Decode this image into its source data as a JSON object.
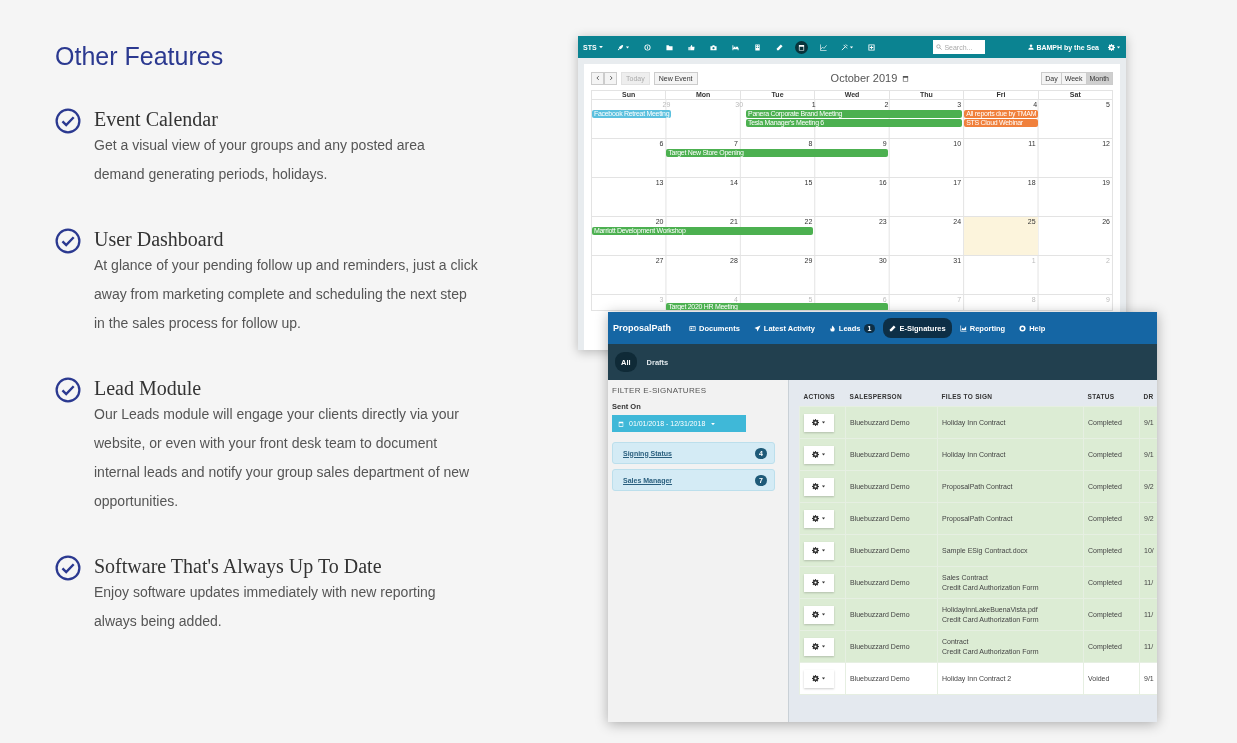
{
  "features": {
    "heading": "Other Features",
    "items": [
      {
        "title": "Event Calendar",
        "text": "Get a visual view of your groups and any posted area demand generating periods, holidays."
      },
      {
        "title": "User Dashboard",
        "text": "At glance of your pending follow up and reminders, just a click away from marketing complete and scheduling the next step in the sales process for follow up."
      },
      {
        "title": "Lead Module",
        "text": "Our Leads module will engage your clients directly via your website, or even with your front desk team to document internal leads and notify your group sales department of new opportunities."
      },
      {
        "title": "Software That's Always Up To Date",
        "text": "Enjoy software updates immediately with new reporting always being added."
      }
    ]
  },
  "calendar_app": {
    "brand": "STS",
    "toolbar_icons": [
      {
        "kind": "rocket",
        "caret": true,
        "selected": false
      },
      {
        "kind": "info",
        "caret": false,
        "selected": false
      },
      {
        "kind": "folder",
        "caret": false,
        "selected": false
      },
      {
        "kind": "thumb",
        "caret": false,
        "selected": false
      },
      {
        "kind": "camera",
        "caret": false,
        "selected": false
      },
      {
        "kind": "bed",
        "caret": false,
        "selected": false
      },
      {
        "kind": "building",
        "caret": false,
        "selected": false
      },
      {
        "kind": "pen",
        "caret": false,
        "selected": false
      },
      {
        "kind": "calendar",
        "caret": false,
        "selected": true
      },
      {
        "kind": "chart",
        "caret": false,
        "selected": false
      },
      {
        "kind": "tools",
        "caret": true,
        "selected": false
      },
      {
        "kind": "plus",
        "caret": false,
        "selected": false
      }
    ],
    "search": {
      "placeholder": "Search..."
    },
    "user": "BAMPH by the Sea",
    "buttons": [
      {
        "label": "Today",
        "disabled": true
      },
      {
        "label": "New Event",
        "disabled": false
      }
    ],
    "month_title": "October 2019",
    "views": [
      {
        "label": "Day",
        "selected": false
      },
      {
        "label": "Week",
        "selected": false
      },
      {
        "label": "Month",
        "selected": true
      }
    ],
    "weekdays": [
      "Sun",
      "Mon",
      "Tue",
      "Wed",
      "Thu",
      "Fri",
      "Sat"
    ],
    "weeks": [
      {
        "days": [
          {
            "day": "29",
            "other_month": true,
            "today": false,
            "events": [
              {
                "title": "Facebook Retreat Meeting",
                "color": "#5bc0de",
                "kind": "single"
              }
            ]
          },
          {
            "day": "30",
            "other_month": true,
            "today": false
          },
          {
            "day": "1",
            "other_month": false,
            "today": false,
            "events": [
              {
                "title": "Panera Corporate Brand Meeting",
                "color": "#4cb050",
                "kind": "triple"
              },
              {
                "title": "Tesla Manager's Meeting 6",
                "color": "#4cb050",
                "kind": "triple"
              }
            ]
          },
          {
            "day": "2",
            "other_month": false,
            "today": false
          },
          {
            "day": "3",
            "other_month": false,
            "today": false
          },
          {
            "day": "4",
            "other_month": false,
            "today": false,
            "events": [
              {
                "title": "All reports due by TMAM",
                "color": "#f0803c",
                "kind": "single"
              },
              {
                "title": "STS Cloud Webinar",
                "color": "#f0803c",
                "kind": "single"
              }
            ]
          },
          {
            "day": "5",
            "other_month": false,
            "today": false
          }
        ]
      },
      {
        "days": [
          {
            "day": "6",
            "other_month": false,
            "today": false
          },
          {
            "day": "7",
            "other_month": false,
            "today": false,
            "events": [
              {
                "title": "Target New Store Opening",
                "color": "#4cb050",
                "kind": "triple"
              }
            ]
          },
          {
            "day": "8",
            "other_month": false,
            "today": false
          },
          {
            "day": "9",
            "other_month": false,
            "today": false
          },
          {
            "day": "10",
            "other_month": false,
            "today": false
          },
          {
            "day": "11",
            "other_month": false,
            "today": false
          },
          {
            "day": "12",
            "other_month": false,
            "today": false
          }
        ]
      },
      {
        "days": [
          {
            "day": "13",
            "other_month": false,
            "today": false
          },
          {
            "day": "14",
            "other_month": false,
            "today": false
          },
          {
            "day": "15",
            "other_month": false,
            "today": false
          },
          {
            "day": "16",
            "other_month": false,
            "today": false
          },
          {
            "day": "17",
            "other_month": false,
            "today": false
          },
          {
            "day": "18",
            "other_month": false,
            "today": false
          },
          {
            "day": "19",
            "other_month": false,
            "today": false
          }
        ]
      },
      {
        "days": [
          {
            "day": "20",
            "other_month": false,
            "today": false,
            "events": [
              {
                "title": "Marriott Development Workshop",
                "color": "#4cb050",
                "kind": "triple"
              }
            ]
          },
          {
            "day": "21",
            "other_month": false,
            "today": false
          },
          {
            "day": "22",
            "other_month": false,
            "today": false
          },
          {
            "day": "23",
            "other_month": false,
            "today": false
          },
          {
            "day": "24",
            "other_month": false,
            "today": false
          },
          {
            "day": "25",
            "other_month": false,
            "today": true
          },
          {
            "day": "26",
            "other_month": false,
            "today": false
          }
        ]
      },
      {
        "days": [
          {
            "day": "27",
            "other_month": false,
            "today": false
          },
          {
            "day": "28",
            "other_month": false,
            "today": false
          },
          {
            "day": "29",
            "other_month": false,
            "today": false
          },
          {
            "day": "30",
            "other_month": false,
            "today": false
          },
          {
            "day": "31",
            "other_month": false,
            "today": false
          },
          {
            "day": "1",
            "other_month": true,
            "today": false
          },
          {
            "day": "2",
            "other_month": true,
            "today": false
          }
        ]
      },
      {
        "days": [
          {
            "day": "3",
            "other_month": true,
            "today": false
          },
          {
            "day": "4",
            "other_month": true,
            "today": false,
            "events": [
              {
                "title": "Target 2020 HR Meeting",
                "color": "#4cb050",
                "kind": "triple"
              }
            ]
          },
          {
            "day": "5",
            "other_month": true,
            "today": false
          },
          {
            "day": "6",
            "other_month": true,
            "today": false
          },
          {
            "day": "7",
            "other_month": true,
            "today": false
          },
          {
            "day": "8",
            "other_month": true,
            "today": false
          },
          {
            "day": "9",
            "other_month": true,
            "today": false
          }
        ]
      }
    ]
  },
  "proposal_app": {
    "brand": "ProposalPath",
    "nav": [
      {
        "label": "Documents",
        "kind": "documents",
        "selected": false
      },
      {
        "label": "Latest Activity",
        "kind": "activity",
        "selected": false
      },
      {
        "label": "Leads",
        "kind": "leads",
        "badge": "1",
        "selected": false
      },
      {
        "label": "E-Signatures",
        "kind": "esign",
        "selected": true
      },
      {
        "label": "Reporting",
        "kind": "reporting",
        "selected": false
      },
      {
        "label": "Help",
        "kind": "help",
        "selected": false
      }
    ],
    "subtabs": [
      {
        "label": "All",
        "selected": true
      },
      {
        "label": "Drafts",
        "selected": false
      }
    ],
    "filter": {
      "title": "FILTER E-SIGNATURES",
      "sent_on_label": "Sent On",
      "date_range": "01/01/2018 - 12/31/2018",
      "groups": [
        {
          "label": "Signing Status",
          "count": "4"
        },
        {
          "label": "Sales Manager",
          "count": "7"
        }
      ]
    },
    "table": {
      "columns": [
        "ACTIONS",
        "SALESPERSON",
        "FILES TO SIGN",
        "STATUS",
        "DR"
      ],
      "rows": [
        {
          "salesperson": "Bluebuzzard Demo",
          "files": [
            "Holiday Inn Contract"
          ],
          "status": "Completed",
          "date": "9/1",
          "highlighted": true
        },
        {
          "salesperson": "Bluebuzzard Demo",
          "files": [
            "Holiday Inn Contract"
          ],
          "status": "Completed",
          "date": "9/1",
          "highlighted": true
        },
        {
          "salesperson": "Bluebuzzard Demo",
          "files": [
            "ProposalPath Contract"
          ],
          "status": "Completed",
          "date": "9/2",
          "highlighted": true
        },
        {
          "salesperson": "Bluebuzzard Demo",
          "files": [
            "ProposalPath Contract"
          ],
          "status": "Completed",
          "date": "9/2",
          "highlighted": true
        },
        {
          "salesperson": "Bluebuzzard Demo",
          "files": [
            "Sample ESig Contract.docx"
          ],
          "status": "Completed",
          "date": "10/",
          "highlighted": true
        },
        {
          "salesperson": "Bluebuzzard Demo",
          "files": [
            "Sales Contract",
            "Credit Card Authorization Form"
          ],
          "status": "Completed",
          "date": "11/",
          "highlighted": true
        },
        {
          "salesperson": "Bluebuzzard Demo",
          "files": [
            "HolidayInnLakeBuenaVista.pdf",
            "Credit Card Authorization Form"
          ],
          "status": "Completed",
          "date": "11/",
          "highlighted": true
        },
        {
          "salesperson": "Bluebuzzard Demo",
          "files": [
            "Contract",
            "Credit Card Authorization Form"
          ],
          "status": "Completed",
          "date": "11/",
          "highlighted": true
        },
        {
          "salesperson": "Bluebuzzard Demo",
          "files": [
            "Holiday Inn Contract 2"
          ],
          "status": "Voided",
          "date": "9/1",
          "highlighted": false
        }
      ]
    }
  }
}
